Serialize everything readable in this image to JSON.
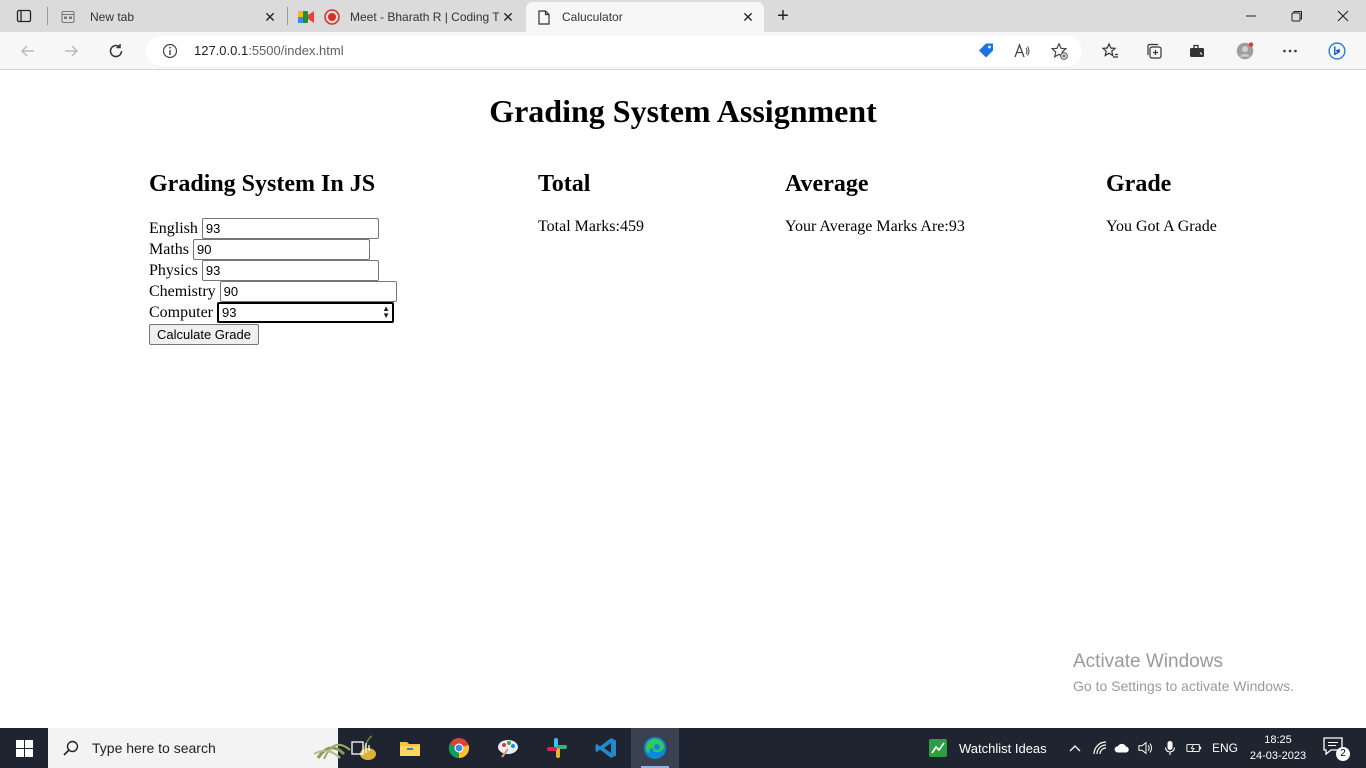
{
  "browser": {
    "tabs": [
      {
        "title": "New tab",
        "icon": "new-tab-page-icon"
      },
      {
        "title": "Meet - Bharath R | Coding T",
        "icon": "google-meet-icon"
      },
      {
        "title": "Caluculator",
        "icon": "document-icon"
      }
    ],
    "url_host": "127.0.0.1",
    "url_rest": ":5500/index.html"
  },
  "page": {
    "title": "Grading System Assignment",
    "form_heading": "Grading System In JS",
    "subjects": [
      {
        "label": "English",
        "value": "93"
      },
      {
        "label": "Maths",
        "value": "90"
      },
      {
        "label": "Physics",
        "value": "93"
      },
      {
        "label": "Chemistry",
        "value": "90"
      },
      {
        "label": "Computer",
        "value": "93"
      }
    ],
    "button_label": "Calculate Grade",
    "total": {
      "heading": "Total",
      "text": "Total Marks:459"
    },
    "average": {
      "heading": "Average",
      "text": "Your Average Marks Are:93"
    },
    "grade": {
      "heading": "Grade",
      "text": "You Got A Grade"
    }
  },
  "watermark": {
    "line1": "Activate Windows",
    "line2": "Go to Settings to activate Windows."
  },
  "taskbar": {
    "search_placeholder": "Type here to search",
    "widget_text": "Watchlist Ideas",
    "language": "ENG",
    "time": "18:25",
    "date": "24-03-2023",
    "notification_count": "2"
  }
}
